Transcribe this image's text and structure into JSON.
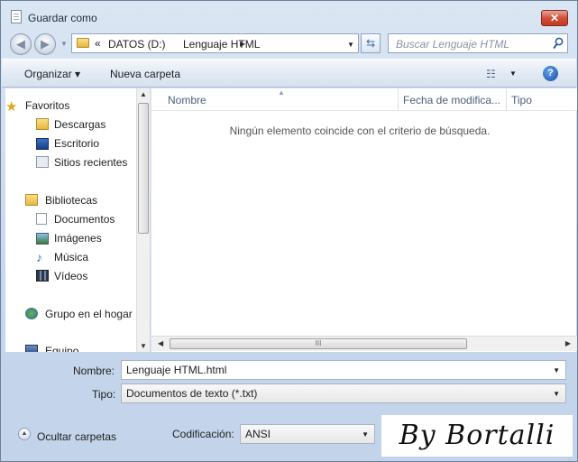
{
  "window": {
    "title": "Guardar como",
    "close_label": "✕"
  },
  "address_bar": {
    "overflow": "«",
    "segments": [
      "DATOS (D:)",
      "Lenguaje HTML"
    ]
  },
  "search": {
    "placeholder": "Buscar Lenguaje HTML"
  },
  "toolbar": {
    "organize_label": "Organizar",
    "new_folder_label": "Nueva carpeta",
    "view_icon": "details-view-icon",
    "help_label": "?"
  },
  "navigation": {
    "items": [
      {
        "label": "Favoritos",
        "icon": "star-icon",
        "level": 0
      },
      {
        "label": "Descargas",
        "icon": "downloads-icon",
        "level": 1
      },
      {
        "label": "Escritorio",
        "icon": "desktop-icon",
        "level": 1
      },
      {
        "label": "Sitios recientes",
        "icon": "recent-places-icon",
        "level": 1
      },
      {
        "label": "Bibliotecas",
        "icon": "libraries-icon",
        "level": 0
      },
      {
        "label": "Documentos",
        "icon": "documents-icon",
        "level": 1
      },
      {
        "label": "Imágenes",
        "icon": "pictures-icon",
        "level": 1
      },
      {
        "label": "Música",
        "icon": "music-icon",
        "level": 1
      },
      {
        "label": "Vídeos",
        "icon": "videos-icon",
        "level": 1
      },
      {
        "label": "Grupo en el hogar",
        "icon": "homegroup-icon",
        "level": 0
      },
      {
        "label": "Equipo",
        "icon": "computer-icon",
        "level": 0
      }
    ]
  },
  "file_list": {
    "columns": [
      "Nombre",
      "Fecha de modifica...",
      "Tipo"
    ],
    "empty_message": "Ningún elemento coincide con el criterio de búsqueda.",
    "hscroll_grip": "III"
  },
  "form": {
    "filename_label": "Nombre:",
    "filename_value": "Lenguaje HTML.html",
    "type_label": "Tipo:",
    "type_value": "Documentos de texto (*.txt)",
    "encoding_label": "Codificación:",
    "encoding_value": "ANSI",
    "hide_folders_label": "Ocultar carpetas"
  },
  "watermark": "By Bortalli",
  "colors": {
    "accent": "#1b4fa3",
    "frame": "#c6d6ec",
    "close": "#c23a22"
  }
}
